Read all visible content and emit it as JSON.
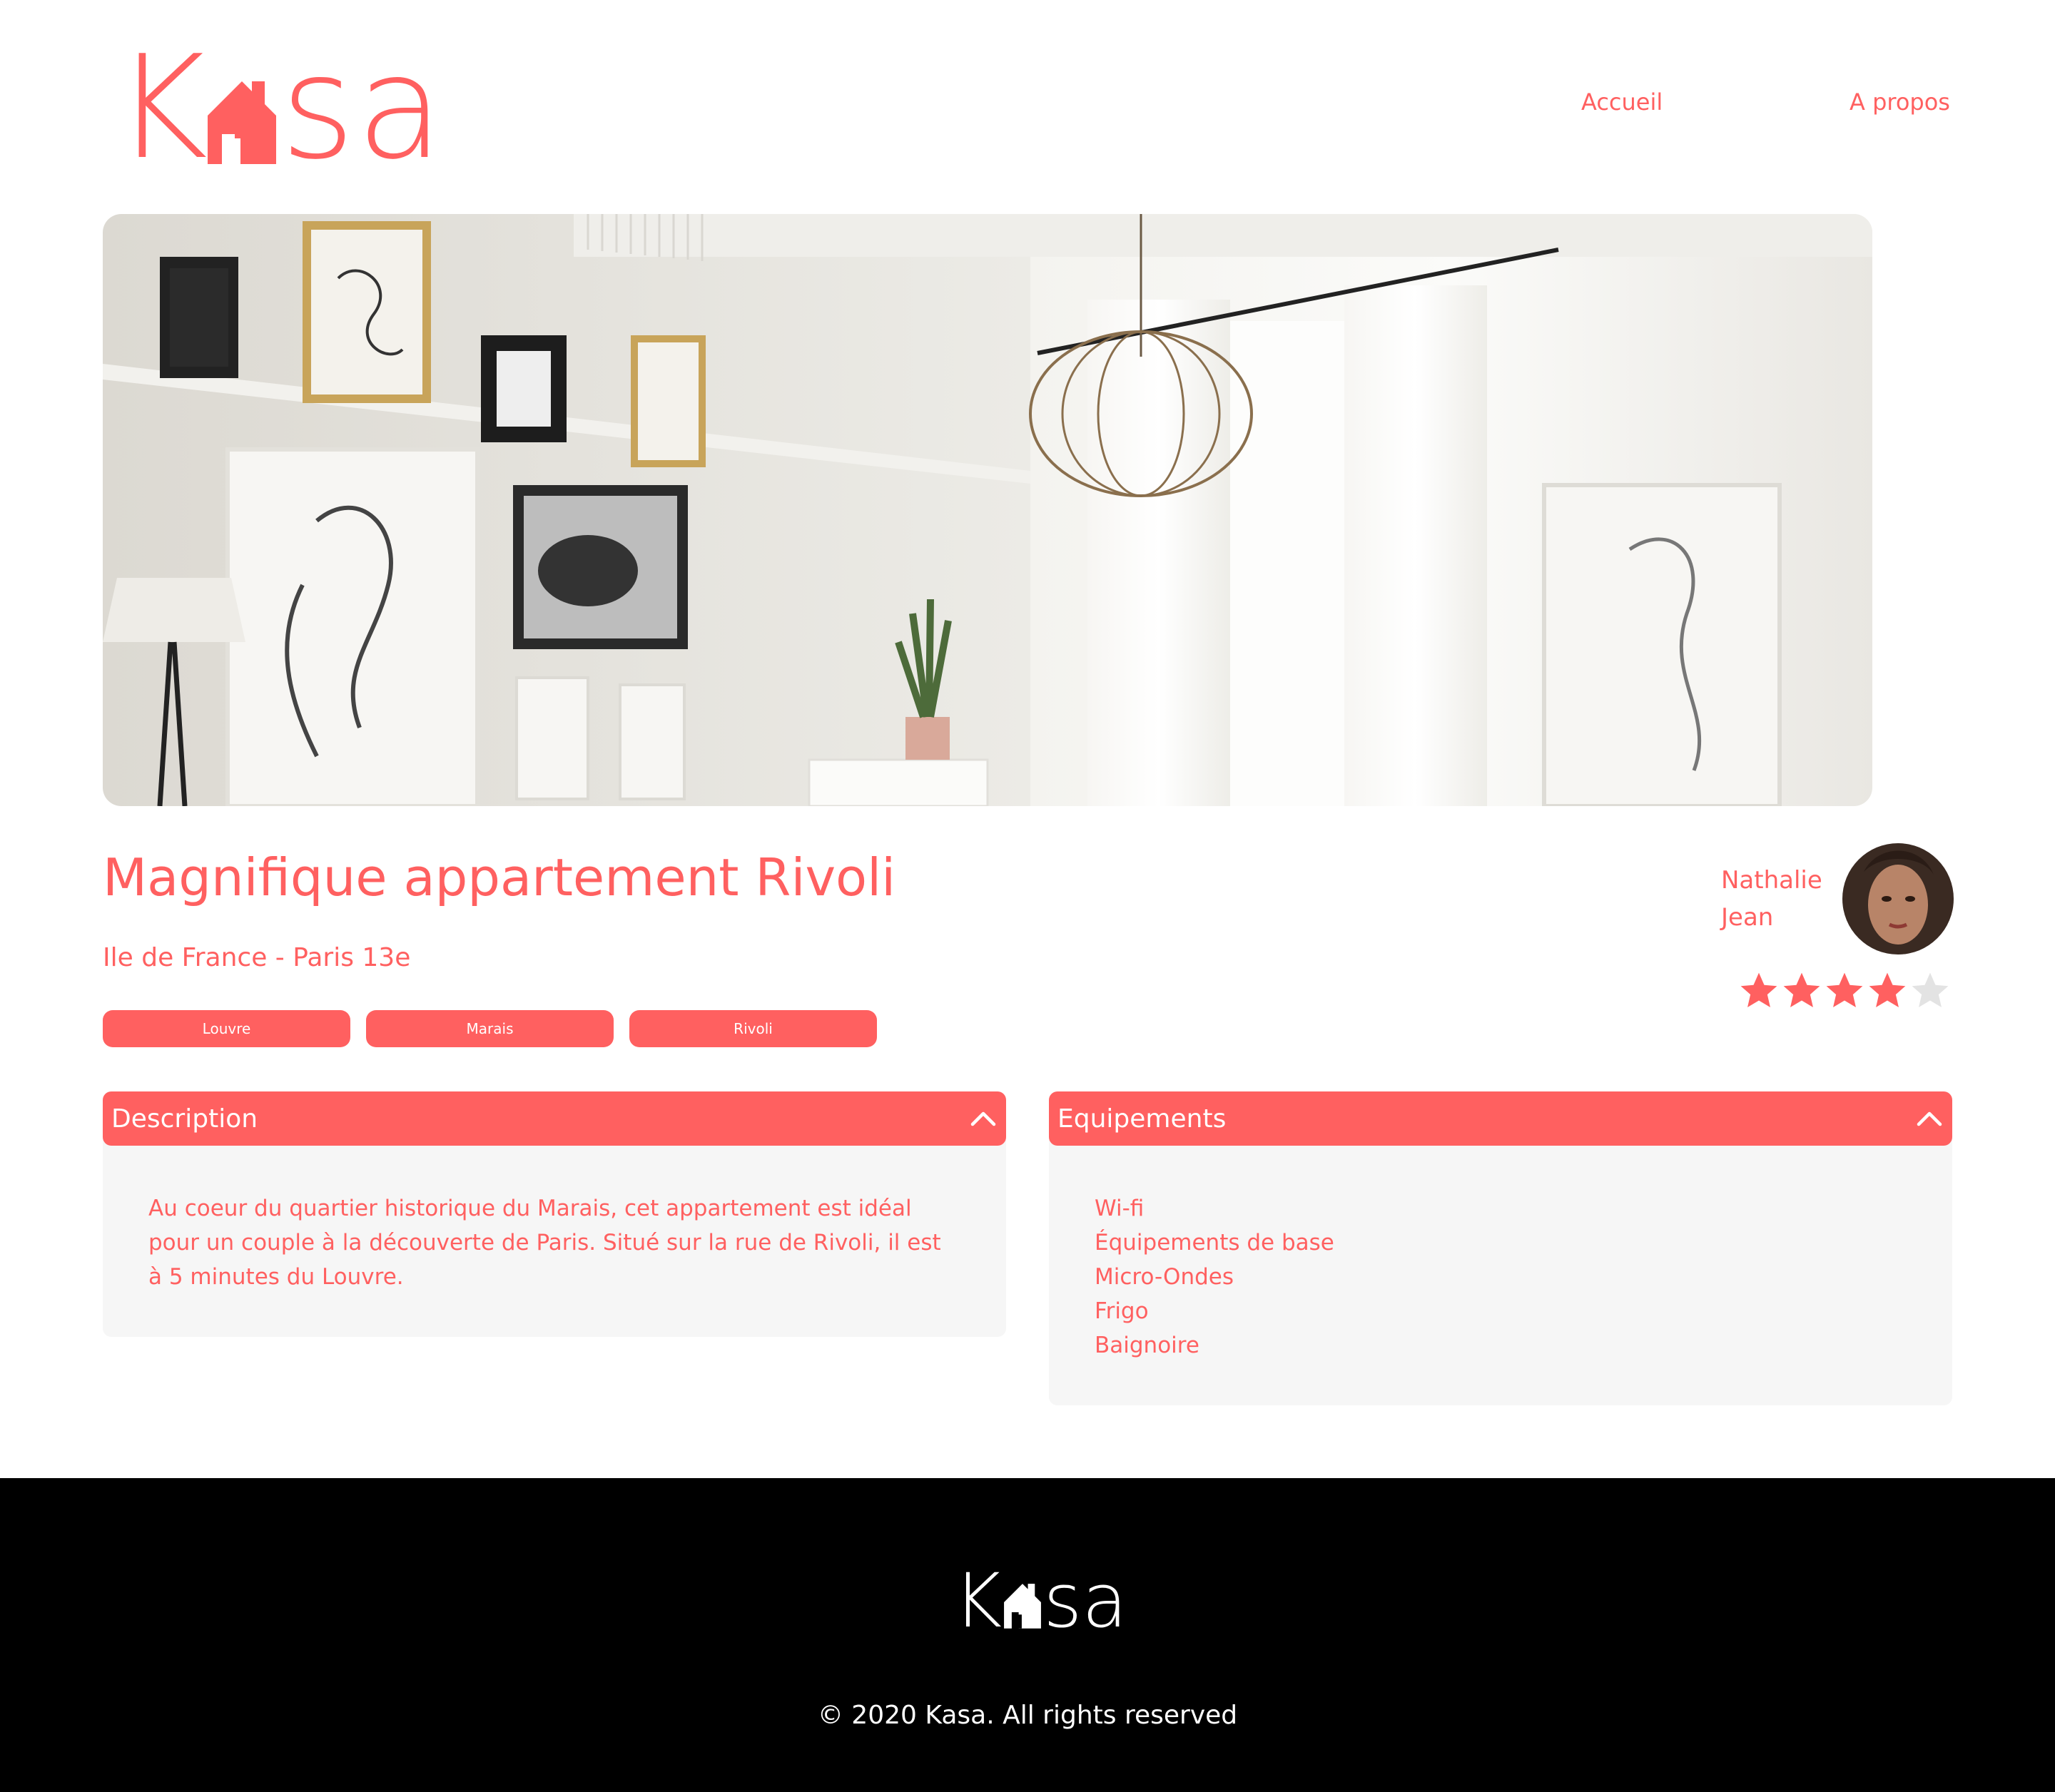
{
  "brand": {
    "logo_letter_start": "K",
    "logo_letter_end": "sa",
    "primary_color": "#FF6060"
  },
  "nav": {
    "home": "Accueil",
    "about": "A propos"
  },
  "listing": {
    "title": "Magnifique appartement Rivoli",
    "location": "Ile de France - Paris 13e",
    "tags": [
      "Louvre",
      "Marais",
      "Rivoli"
    ],
    "host": {
      "first_name": "Nathalie",
      "last_name": "Jean"
    },
    "rating": 4,
    "rating_max": 5
  },
  "description": {
    "title": "Description",
    "text": "Au coeur du quartier historique du Marais, cet appartement est idéal pour un couple à la découverte de Paris. Situé sur la rue de Rivoli, il est à 5 minutes du Louvre."
  },
  "equipments": {
    "title": "Equipements",
    "items": [
      "Wi-fi",
      "Équipements de base",
      "Micro-Ondes",
      "Frigo",
      "Baignoire"
    ]
  },
  "footer": {
    "logo_letter_start": "K",
    "logo_letter_end": "sa",
    "copyright": "© 2020 Kasa. All rights reserved"
  },
  "icons": {
    "logo_house": "house-icon",
    "chevron": "chevron-up-icon",
    "star": "star-icon"
  }
}
